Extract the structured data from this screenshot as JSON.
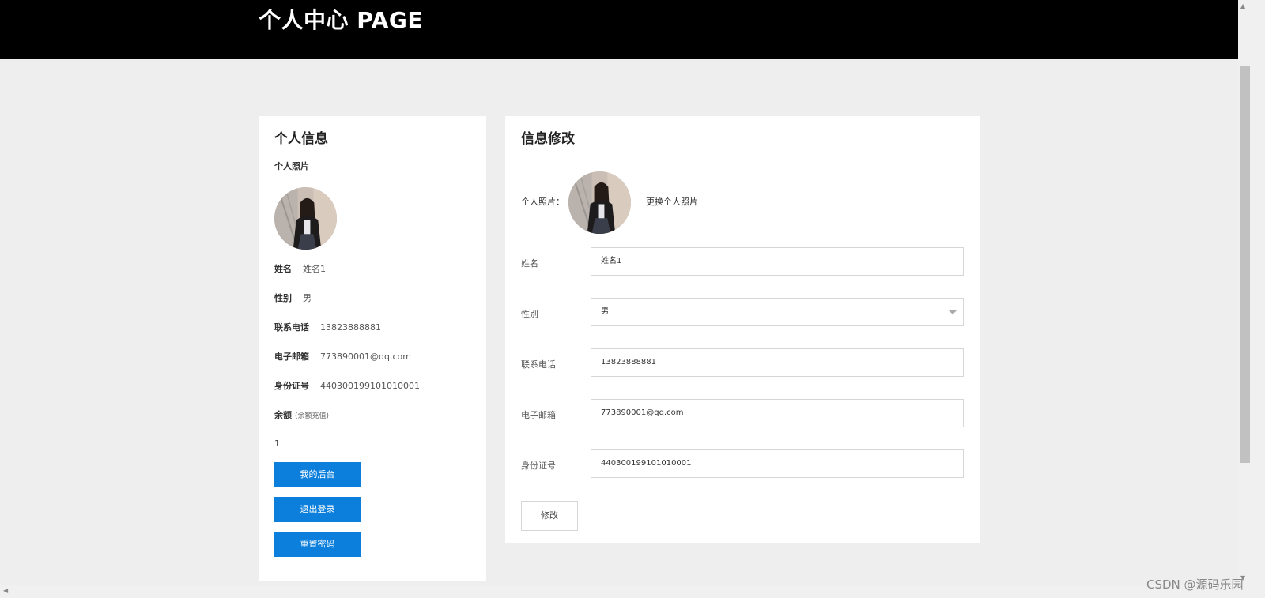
{
  "header": {
    "title": "个人中心 PAGE"
  },
  "profile": {
    "heading": "个人信息",
    "photo_label": "个人照片",
    "fields": [
      {
        "label": "姓名",
        "value": "姓名1"
      },
      {
        "label": "性别",
        "value": "男"
      },
      {
        "label": "联系电话",
        "value": "13823888881"
      },
      {
        "label": "电子邮箱",
        "value": "773890001@qq.com"
      },
      {
        "label": "身份证号",
        "value": "440300199101010001"
      }
    ],
    "balance_label": "余额",
    "balance_hint": "(余额充值)",
    "balance_value": "1",
    "buttons": {
      "backend": "我的后台",
      "logout": "退出登录",
      "reset_password": "重置密码"
    }
  },
  "edit": {
    "heading": "信息修改",
    "photo_label": "个人照片：",
    "change_photo": "更换个人照片",
    "fields": [
      {
        "label": "姓名",
        "value": "姓名1"
      },
      {
        "label": "性别",
        "value": "男"
      },
      {
        "label": "联系电话",
        "value": "13823888881"
      },
      {
        "label": "电子邮箱",
        "value": "773890001@qq.com"
      },
      {
        "label": "身份证号",
        "value": "440300199101010001"
      }
    ],
    "submit": "修改"
  },
  "watermark": "CSDN @源码乐园",
  "colors": {
    "header_bg": "#000000",
    "accent": "#0b7fdb",
    "page_bg": "#eeeeee"
  }
}
